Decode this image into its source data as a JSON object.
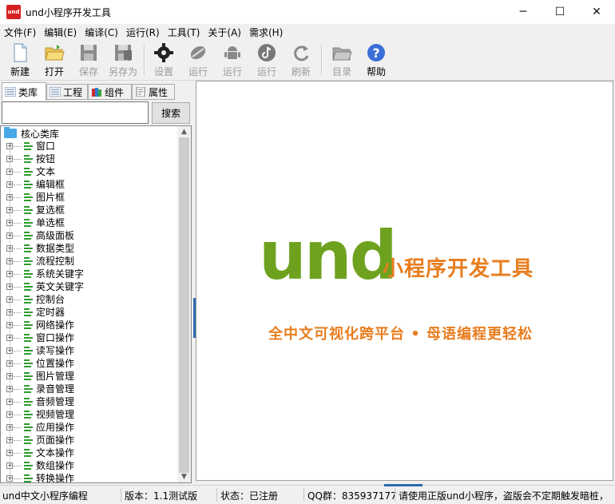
{
  "window": {
    "app_icon_text": "und",
    "title": "und小程序开发工具",
    "controls": {
      "minimize": "─",
      "maximize": "☐",
      "close": "✕"
    }
  },
  "menu": [
    "文件(F)",
    "编辑(E)",
    "编译(C)",
    "运行(R)",
    "工具(T)",
    "关于(A)",
    "需求(H)"
  ],
  "toolbar": [
    {
      "label": "新建",
      "icon": "new-file-icon",
      "enabled": true
    },
    {
      "label": "打开",
      "icon": "open-folder-icon",
      "enabled": true
    },
    {
      "label": "保存",
      "icon": "save-icon",
      "enabled": false
    },
    {
      "label": "另存为",
      "icon": "save-as-icon",
      "enabled": false
    },
    {
      "label": "设置",
      "icon": "gear-icon",
      "enabled": false
    },
    {
      "label": "运行",
      "icon": "run-icon",
      "enabled": false
    },
    {
      "label": "运行",
      "icon": "android-icon",
      "enabled": false
    },
    {
      "label": "运行",
      "icon": "tiktok-icon",
      "enabled": false
    },
    {
      "label": "刷新",
      "icon": "refresh-icon",
      "enabled": false
    },
    {
      "label": "目录",
      "icon": "folder-icon",
      "enabled": false
    },
    {
      "label": "帮助",
      "icon": "help-icon",
      "enabled": true
    }
  ],
  "left_tabs": [
    {
      "label": "类库",
      "active": true
    },
    {
      "label": "工程",
      "active": false
    },
    {
      "label": "组件",
      "active": false
    },
    {
      "label": "属性",
      "active": false
    }
  ],
  "search": {
    "value": "",
    "button": "搜索"
  },
  "tree": {
    "root": "核心类库",
    "items": [
      "窗口",
      "按钮",
      "文本",
      "编辑框",
      "图片框",
      "复选框",
      "单选框",
      "高级面板",
      "数据类型",
      "流程控制",
      "系统关键字",
      "英文关键字",
      "控制台",
      "定时器",
      "网络操作",
      "窗口操作",
      "读写操作",
      "位置操作",
      "图片管理",
      "录音管理",
      "音频管理",
      "视频管理",
      "应用操作",
      "页面操作",
      "文本操作",
      "数组操作",
      "转换操作"
    ]
  },
  "splash": {
    "logo": "und",
    "product": "小程序开发工具",
    "slogan": "全中文可视化跨平台 • 母语编程更轻松"
  },
  "status": {
    "app": "und中文小程序编程",
    "version": "版本：1.1测试版",
    "state": "状态：已注册",
    "qq": "QQ群：835937177",
    "notice": "请使用正版und小程序，盗版会不定期触发暗桩，"
  },
  "colors": {
    "logo_green": "#6ea21e",
    "accent_orange": "#e87d1e",
    "brand_red": "#d42020",
    "tree_bar_green": "#2e9c2e"
  }
}
